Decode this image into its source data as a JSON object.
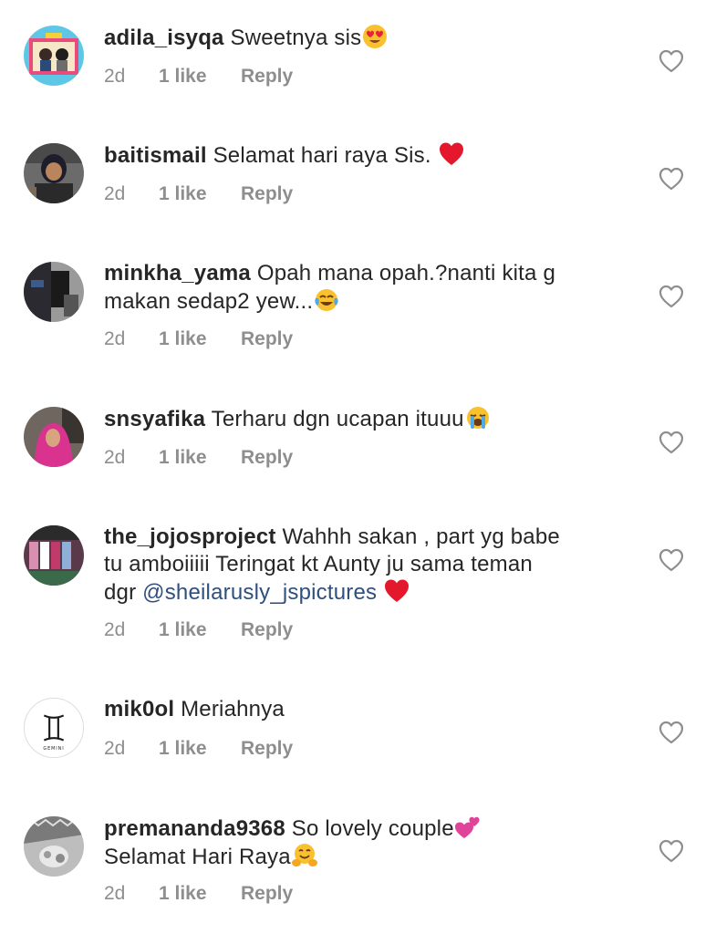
{
  "comments": [
    {
      "username": "adila_isyqa",
      "text": "Sweetnya sis",
      "text_lines": [],
      "mention": "",
      "trailing_emoji": "heart-eyes-emoji",
      "time": "2d",
      "likes": "1 like",
      "reply": "Reply",
      "avatar_icon": "avatar-photo-illustration"
    },
    {
      "username": "baitismail",
      "text": "Selamat hari raya Sis.",
      "text_lines": [],
      "mention": "",
      "trailing_emoji": "red-heart-emoji",
      "time": "2d",
      "likes": "1 like",
      "reply": "Reply",
      "avatar_icon": "avatar-photo-woman"
    },
    {
      "username": "minkha_yama",
      "text": "Opah mana opah.?nanti kita g",
      "text_lines": [
        "makan sedap2 yew..."
      ],
      "mention": "",
      "trailing_emoji": "tears-of-joy-emoji",
      "time": "2d",
      "likes": "1 like",
      "reply": "Reply",
      "avatar_icon": "avatar-photo-dark"
    },
    {
      "username": "snsyafika",
      "text": "Terharu dgn ucapan ituuu",
      "text_lines": [],
      "mention": "",
      "trailing_emoji": "loudly-crying-emoji",
      "time": "2d",
      "likes": "1 like",
      "reply": "Reply",
      "avatar_icon": "avatar-photo-hijab"
    },
    {
      "username": "the_jojosproject",
      "text": "Wahhh sakan , part yg babe",
      "text_lines": [
        "tu amboiiiii Teringat  kt Aunty ju sama teman",
        "dgr"
      ],
      "mention": "@sheilarusly_jspictures",
      "trailing_emoji": "red-heart-emoji",
      "time": "2d",
      "likes": "1 like",
      "reply": "Reply",
      "avatar_icon": "avatar-photo-store"
    },
    {
      "username": "mik0ol",
      "text": "Meriahnya",
      "text_lines": [],
      "mention": "",
      "trailing_emoji": "",
      "time": "2d",
      "likes": "1 like",
      "reply": "Reply",
      "avatar_icon": "avatar-gemini-logo",
      "avatar_caption": "GEMINI"
    },
    {
      "username": "premananda9368",
      "text": "So lovely couple",
      "text_lines": [
        "Selamat Hari Raya"
      ],
      "mention": "",
      "trailing_emoji": "two-hearts-emoji",
      "second_line_emoji": "hugging-face-emoji",
      "time": "2d",
      "likes": "1 like",
      "reply": "Reply",
      "avatar_icon": "avatar-photo-grey"
    }
  ],
  "colors": {
    "text": "#262626",
    "meta": "#8e8e8e",
    "mention": "#2f4f7f",
    "heart_outline": "#8e8e8e"
  }
}
